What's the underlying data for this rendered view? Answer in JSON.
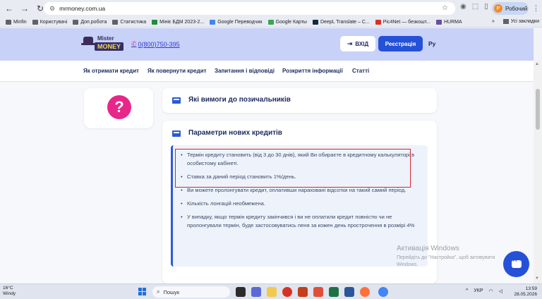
{
  "browser": {
    "url": "mrmoney.com.ua",
    "profile_label": "Робочий",
    "profile_initial": "Р",
    "bookmarks": [
      "Minfin",
      "Користувачі",
      "Доп.робота",
      "Статистика",
      "Мініє БДМ 2023-2...",
      "Google Переводчик",
      "Google Карты",
      "DeepL Translate – C...",
      "Pic4Net — безкошт...",
      "HURMA"
    ],
    "bookmarks_more": "»",
    "all_bookmarks": "Усі закладки"
  },
  "header": {
    "logo_top": "Mister",
    "logo_bottom": "MONEY",
    "phone": "0(800)750-395",
    "login_label": "ВХІД",
    "register_label": "Реєстрація",
    "lang": "Ру"
  },
  "nav": {
    "items": [
      "Як отримати кредит",
      "Як повернути кредит",
      "Запитання і відповіді",
      "Розкриття інформації",
      "Статті"
    ]
  },
  "content": {
    "question_mark": "?",
    "accordion1_title": "Які вимоги до позичальників",
    "accordion2_title": "Параметри нових кредитів",
    "items": [
      "Термін кредиту становить (від 3 до 30 днів), який Ви обираєте в кредитному калькуляторі в особистому кабінеті.",
      "Ставка за даний період становить 1%/день.",
      "Ви можете пролонгувати кредит, оплативши нараховані відсотки на такий самий період.",
      "Кількість лонгацій необмежена.",
      "У випадку, якщо термін кредиту закінчився і ви не оплатили кредит повністю чи не пролонгували термін, буде застосовуватись пеня за кожен день прострочення в розмірі 4%"
    ]
  },
  "watermark": {
    "title": "Активація Windows",
    "text": "Перейдіть до \"Настройка\", щоб активувати Windows."
  },
  "taskbar": {
    "temp": "16°C",
    "weather": "Windy",
    "search_placeholder": "Пошук",
    "lang": "УКР",
    "time": "13:59",
    "date": "28.05.2026"
  }
}
